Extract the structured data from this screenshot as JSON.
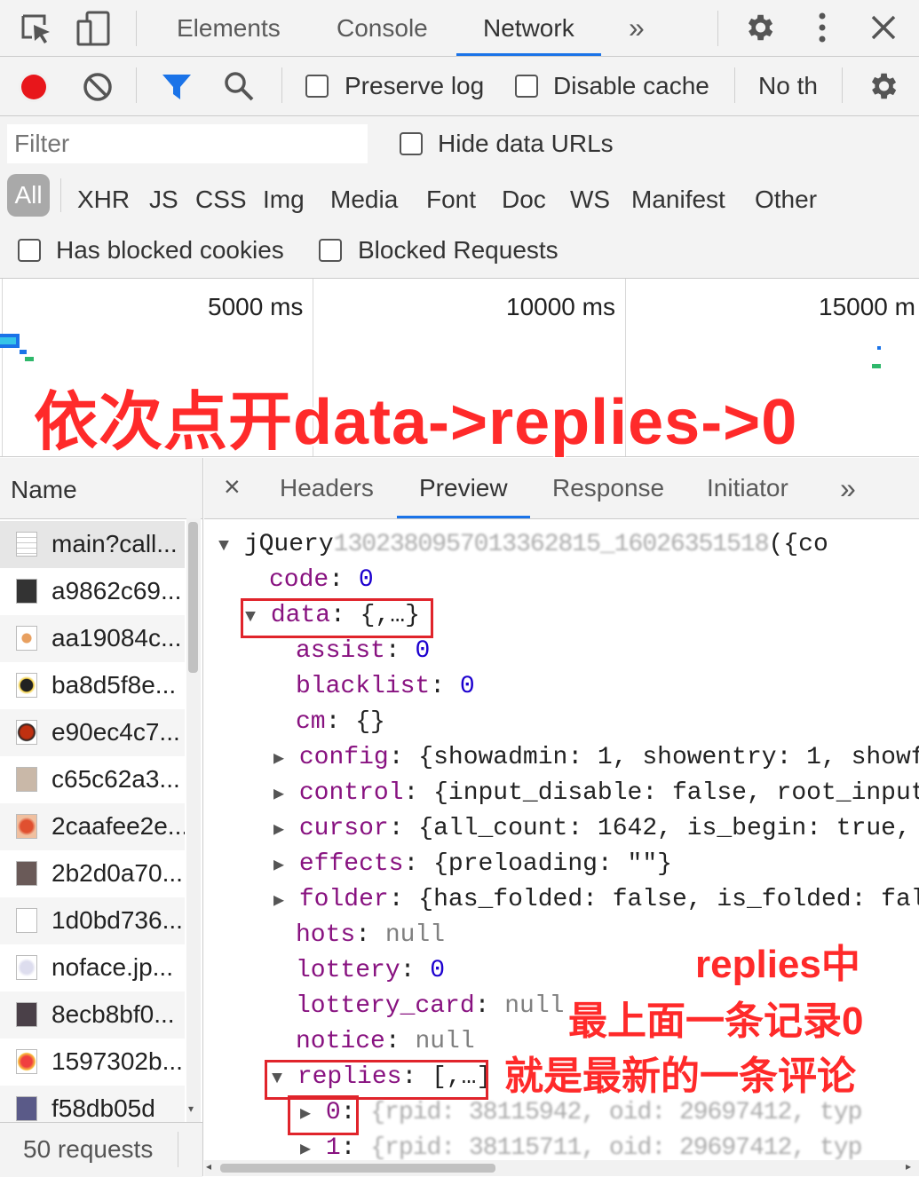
{
  "top_tabs": [
    "Elements",
    "Console",
    "Network"
  ],
  "top_tabs_more": "»",
  "toolbar": {
    "preserve_log": "Preserve log",
    "disable_cache": "Disable cache",
    "throttling": "No th"
  },
  "filter": {
    "placeholder": "Filter",
    "hide_data_urls": "Hide data URLs",
    "types": [
      "All",
      "XHR",
      "JS",
      "CSS",
      "Img",
      "Media",
      "Font",
      "Doc",
      "WS",
      "Manifest",
      "Other"
    ],
    "has_blocked_cookies": "Has blocked cookies",
    "blocked_requests": "Blocked Requests"
  },
  "timeline": {
    "labels": [
      "5000 ms",
      "10000 ms",
      "15000 m"
    ],
    "annotation": "依次点开data->replies->0"
  },
  "name_pane": {
    "header": "Name",
    "rows": [
      "main?call...",
      "a9862c69...",
      "aa19084c...",
      "ba8d5f8e...",
      "e90ec4c7...",
      "c65c62a3...",
      "2caafee2e...",
      "2b2d0a70...",
      "1d0bd736...",
      "noface.jp...",
      "8ecb8bf0...",
      "1597302b...",
      "f58db05d"
    ],
    "footer": "50 requests"
  },
  "preview": {
    "close": "×",
    "tabs": [
      "Headers",
      "Preview",
      "Response",
      "Initiator"
    ],
    "more": "»",
    "root_prefix": "jQuery",
    "root_suffix": "({co",
    "lines": {
      "code_key": "code",
      "code_val": "0",
      "data_key": "data",
      "data_val": "{,…}",
      "assist_key": "assist",
      "assist_val": "0",
      "blacklist_key": "blacklist",
      "blacklist_val": "0",
      "cm_key": "cm",
      "cm_val": "{}",
      "config_key": "config",
      "config_val": "{showadmin: 1, showentry: 1, showf",
      "control_key": "control",
      "control_val": "{input_disable: false, root_input",
      "cursor_key": "cursor",
      "cursor_val": "{all_count: 1642, is_begin: true,",
      "effects_key": "effects",
      "effects_val": "{preloading: \"\"}",
      "folder_key": "folder",
      "folder_val": "{has_folded: false, is_folded: fal",
      "hots_key": "hots",
      "hots_val": "null",
      "lottery_key": "lottery",
      "lottery_val": "0",
      "lottery_card_key": "lottery_card",
      "lottery_card_val": "null",
      "notice_key": "notice",
      "notice_val": "null",
      "replies_key": "replies",
      "replies_val": "[,…]",
      "idx0_key": "0",
      "idx1_key": "1"
    },
    "annotation_lines": [
      "replies中",
      "最上面一条记录0",
      "就是最新的一条评论"
    ]
  }
}
